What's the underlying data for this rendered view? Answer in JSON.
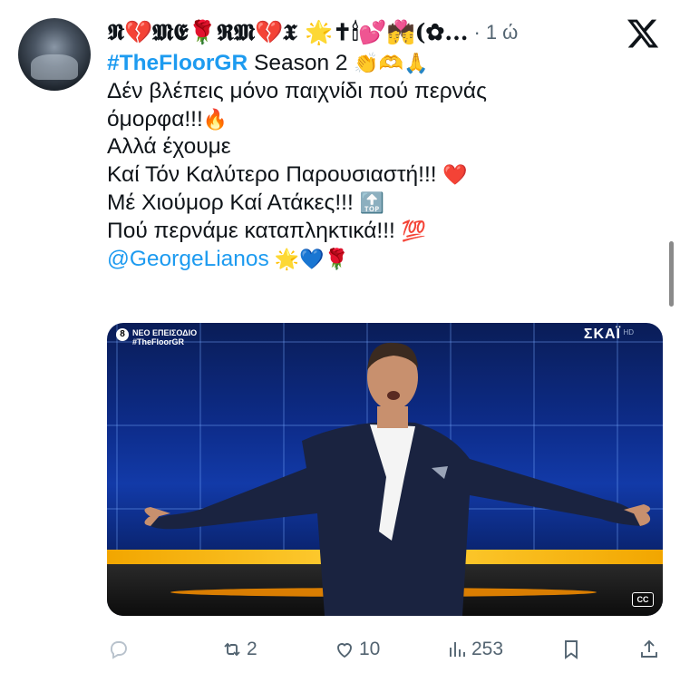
{
  "post": {
    "display_name": "𝕹💔𝕸𝕰🌹𝕽𝕸💔𝖃 🌟✝🕯💕💏(✿...",
    "separator": "·",
    "time": "1 ώ",
    "lines": {
      "l1": {
        "hashtag": "#TheFloorGR",
        "text": " Season 2 ",
        "emoji": "👏🫶🙏"
      },
      "l2": "Δέν βλέπεις μόνο παιχνίδι πού περνάς",
      "l3": {
        "text": "όμορφα!!!",
        "emoji": "🔥"
      },
      "l4": "Αλλά έχουμε",
      "l5": {
        "text": " Καί Τόν Καλύτερο Παρουσιαστή!!! ",
        "emoji": "❤️"
      },
      "l6": {
        "text": "Μέ Χιούμορ Καί Ατάκες!!! ",
        "emoji": "🔝"
      },
      "l7": {
        "text": "Πού περνάμε καταπληκτικά!!! ",
        "emoji": "💯"
      },
      "l8": {
        "mention": "@GeorgeLianos",
        "emoji": " 🌟💙🌹"
      }
    }
  },
  "media": {
    "badge_number": "8",
    "badge_line1": "ΝΕΟ ΕΠΕΙΣΟΔΙΟ",
    "badge_line2": "#TheFloorGR",
    "channel": "ΣΚΑΪ",
    "channel_hd": "HD",
    "cc": "CC"
  },
  "actions": {
    "reposts": "2",
    "likes": "10",
    "views": "253"
  },
  "icons": [
    "x-logo-icon",
    "reply-icon",
    "repost-icon",
    "like-icon",
    "views-icon",
    "bookmark-icon",
    "share-icon"
  ],
  "colors": {
    "link": "#1d9bf0",
    "muted": "#536471",
    "text": "#0f1419"
  }
}
